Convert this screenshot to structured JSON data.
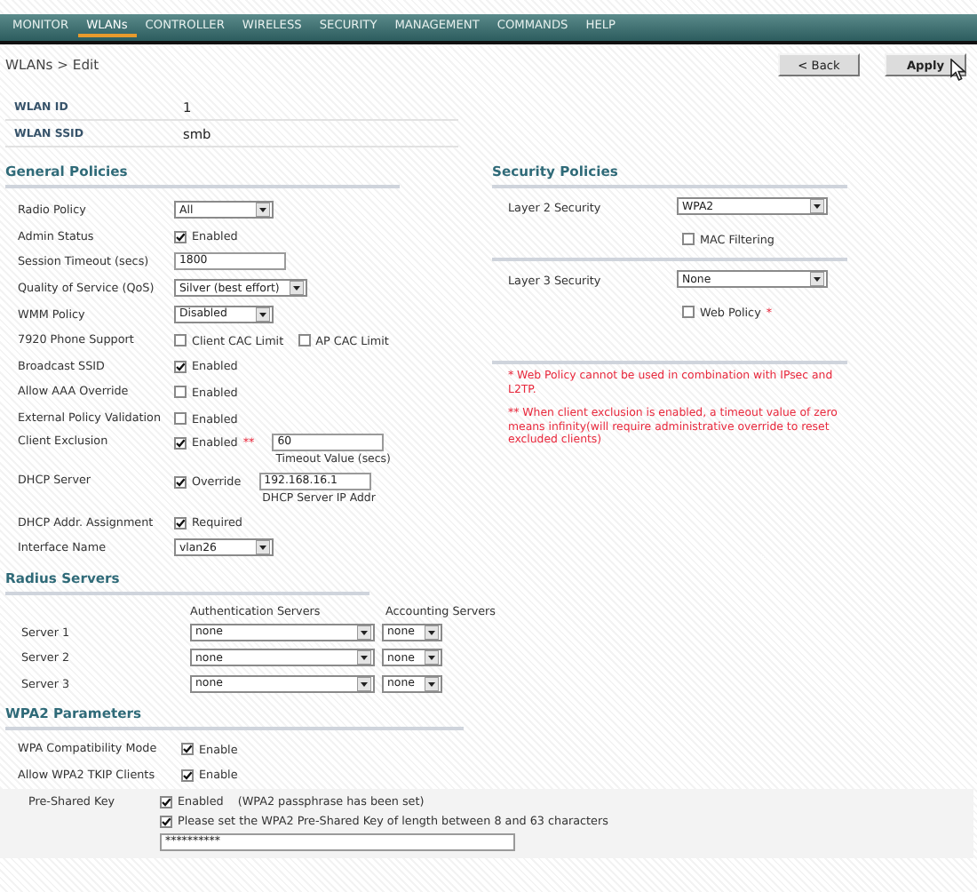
{
  "menu": [
    {
      "label": "MONITOR",
      "selected": false
    },
    {
      "label": "WLANs",
      "selected": true
    },
    {
      "label": "CONTROLLER",
      "selected": false
    },
    {
      "label": "WIRELESS",
      "selected": false
    },
    {
      "label": "SECURITY",
      "selected": false
    },
    {
      "label": "MANAGEMENT",
      "selected": false
    },
    {
      "label": "COMMANDS",
      "selected": false
    },
    {
      "label": "HELP",
      "selected": false
    }
  ],
  "breadcrumb": "WLANs > Edit",
  "buttons": [
    "< Back",
    "Apply"
  ],
  "wlan": [
    {
      "label": "WLAN ID",
      "value": "1"
    },
    {
      "label": "WLAN SSID",
      "value": "smb"
    }
  ],
  "general_policies": {
    "title": "General Policies",
    "rows": [
      {
        "label": "Radio Policy",
        "controls": [
          {
            "kind": "select",
            "value": "All"
          }
        ]
      },
      {
        "label": "Admin Status",
        "controls": [
          {
            "kind": "checkbox",
            "label": "Enabled",
            "checked": true
          }
        ]
      },
      {
        "label": "Session Timeout (secs)",
        "controls": [
          {
            "kind": "field",
            "value": "1800"
          }
        ]
      },
      {
        "label": "Quality of Service (QoS)",
        "controls": [
          {
            "kind": "select",
            "value": "Silver (best effort)"
          }
        ]
      },
      {
        "label": "WMM Policy",
        "controls": [
          {
            "kind": "select",
            "value": "Disabled"
          }
        ]
      },
      {
        "label": "7920 Phone Support",
        "controls": [
          {
            "kind": "checkbox",
            "label": "Client CAC Limit",
            "checked": false
          },
          {
            "kind": "checkbox",
            "label": "AP CAC Limit",
            "checked": false
          }
        ]
      },
      {
        "label": "Broadcast SSID",
        "controls": [
          {
            "kind": "checkbox",
            "label": "Enabled",
            "checked": true
          }
        ]
      },
      {
        "label": "Allow AAA Override",
        "controls": [
          {
            "kind": "checkbox",
            "label": "Enabled",
            "checked": false
          }
        ]
      },
      {
        "label": "External Policy Validation",
        "controls": [
          {
            "kind": "checkbox",
            "label": "Enabled",
            "checked": false
          }
        ]
      },
      {
        "label": "Client Exclusion",
        "controls": [
          {
            "kind": "checkbox",
            "label": "Enabled",
            "checked": true,
            "mark": "**"
          },
          {
            "kind": "field",
            "value": "60",
            "caption": "Timeout Value (secs)"
          }
        ]
      },
      {
        "label": "DHCP Server",
        "controls": [
          {
            "kind": "checkbox",
            "label": "Override",
            "checked": true
          },
          {
            "kind": "field",
            "value": "192.168.16.1",
            "caption": "DHCP Server IP Addr"
          }
        ]
      },
      {
        "label": "DHCP Addr. Assignment",
        "controls": [
          {
            "kind": "checkbox",
            "label": "Required",
            "checked": true
          }
        ]
      },
      {
        "label": "Interface Name",
        "controls": [
          {
            "kind": "select",
            "value": "vlan26"
          }
        ]
      }
    ]
  },
  "security_policies": {
    "title": "Security Policies",
    "groups": [
      {
        "label": "Layer 2 Security",
        "select": "WPA2",
        "option": {
          "label": "MAC Filtering",
          "checked": false
        }
      },
      {
        "label": "Layer 3 Security",
        "select": "None",
        "option": {
          "label": "Web Policy",
          "checked": false,
          "mark": "*"
        }
      }
    ],
    "notes": [
      "* Web Policy cannot be used in combination with IPsec and L2TP.",
      "** When client exclusion is enabled, a timeout value of zero means infinity(will require administrative override to reset excluded clients)"
    ]
  },
  "radius_servers": {
    "title": "Radius Servers",
    "columns": [
      "Authentication Servers",
      "Accounting Servers"
    ],
    "rows": [
      {
        "label": "Server 1",
        "authentication": "none",
        "accounting": "none"
      },
      {
        "label": "Server 2",
        "authentication": "none",
        "accounting": "none"
      },
      {
        "label": "Server 3",
        "authentication": "none",
        "accounting": "none"
      }
    ]
  },
  "wpa2_parameters": {
    "title": "WPA2 Parameters",
    "rows": [
      {
        "label": "WPA Compatibility Mode",
        "checkbox": {
          "label": "Enable",
          "checked": true
        }
      },
      {
        "label": "Allow WPA2 TKIP Clients",
        "checkbox": {
          "label": "Enable",
          "checked": true
        }
      }
    ],
    "pre_shared_key": {
      "label": "Pre-Shared Key",
      "enabled": {
        "label": "Enabled",
        "checked": true
      },
      "status": "(WPA2 passphrase has been set)",
      "prompt": {
        "label": "Please set the WPA2 Pre-Shared Key of length between 8 and 63 characters",
        "checked": true
      },
      "value": "**********"
    }
  }
}
